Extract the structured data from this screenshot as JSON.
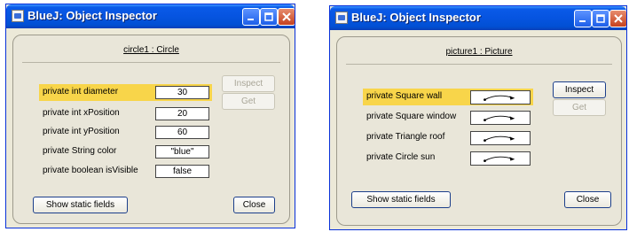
{
  "inspector1": {
    "title": "BlueJ:  Object Inspector",
    "object_name": "circle1 : Circle",
    "fields": [
      {
        "label": "private int diameter",
        "value": "30"
      },
      {
        "label": "private int xPosition",
        "value": "20"
      },
      {
        "label": "private int yPosition",
        "value": "60"
      },
      {
        "label": "private String color",
        "value": "\"blue\""
      },
      {
        "label": "private boolean isVisible",
        "value": "false"
      }
    ],
    "inspect_label": "Inspect",
    "get_label": "Get",
    "static_label": "Show static fields",
    "close_label": "Close"
  },
  "inspector2": {
    "title": "BlueJ:  Object Inspector",
    "object_name": "picture1 : Picture",
    "fields": [
      {
        "label": "private Square wall"
      },
      {
        "label": "private Square window"
      },
      {
        "label": "private Triangle roof"
      },
      {
        "label": "private Circle sun"
      }
    ],
    "inspect_label": "Inspect",
    "get_label": "Get",
    "static_label": "Show static fields",
    "close_label": "Close"
  },
  "colors": {
    "titlebar": "#0654e0",
    "selection": "#f8d54a",
    "window_bg": "#ece9d8"
  }
}
